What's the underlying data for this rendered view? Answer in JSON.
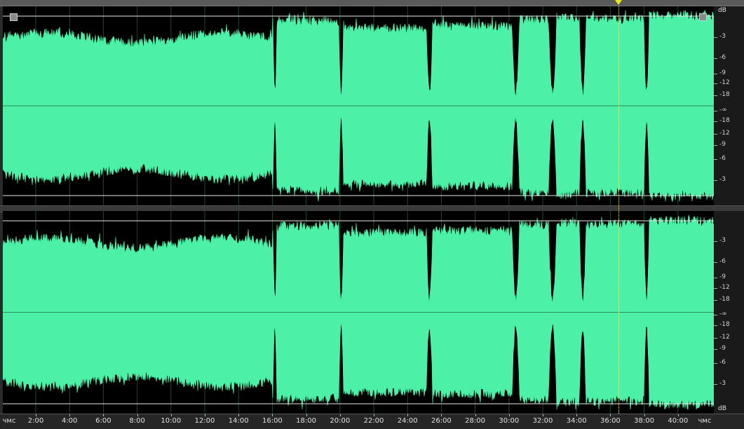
{
  "editor": {
    "unit_top": "dB",
    "unit_bottom": "dB",
    "waveform_color": "#4cf0a6",
    "background_color": "#000000"
  },
  "scale_left": [
    "-3",
    "-6",
    "-9",
    "-12",
    "-18",
    "-∞",
    "-18",
    "-12",
    "-9",
    "-6",
    "-3"
  ],
  "scale_right": [
    "-3",
    "-6",
    "-9",
    "-12",
    "-18",
    "-∞",
    "-18",
    "-12",
    "-9",
    "-6",
    "-3"
  ],
  "timeline": {
    "start_label": "чмс",
    "end_label": "чмс",
    "ticks": [
      "2:00",
      "4:00",
      "6:00",
      "8:00",
      "10:00",
      "12:00",
      "14:00",
      "16:00",
      "18:00",
      "20:00",
      "22:00",
      "24:00",
      "26:00",
      "28:00",
      "30:00",
      "32:00",
      "34:00",
      "36:00",
      "38:00",
      "40:00"
    ]
  },
  "playhead": {
    "time": "36:50"
  }
}
